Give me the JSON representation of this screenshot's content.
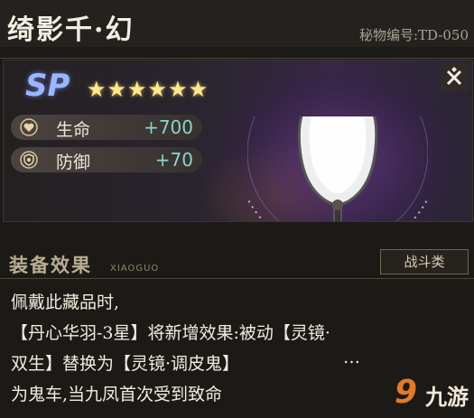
{
  "header": {
    "title": "绮影千·幻",
    "code": "秘物编号:TD-050"
  },
  "artifact": {
    "rarity": "SP",
    "stars": "★★★★★★",
    "star_count": 6,
    "stats": [
      {
        "label": "生命",
        "value": "+700",
        "icon": "heart-icon"
      },
      {
        "label": "防御",
        "value": "+70",
        "icon": "shield-icon"
      }
    ],
    "close_icon": "close-icon",
    "image": "hand-mirror-artifact"
  },
  "section": {
    "title": "装备效果",
    "subtitle": "XIAOGUO",
    "tag": "战斗类"
  },
  "description": {
    "lines": [
      "佩戴此藏品时,",
      "【丹心华羽-3星】将新增效果:被动【灵镜·",
      "双生】替换为【灵镜·调皮鬼】",
      "为鬼车,当九凤首次受到致命"
    ],
    "overflow": "…"
  },
  "watermark": {
    "logo_text": "九游"
  },
  "colors": {
    "stat_value": "#8fd3c6",
    "sp": "#9bb6ff",
    "star": "#ffe88a",
    "logo_accent": "#e37a2a"
  }
}
